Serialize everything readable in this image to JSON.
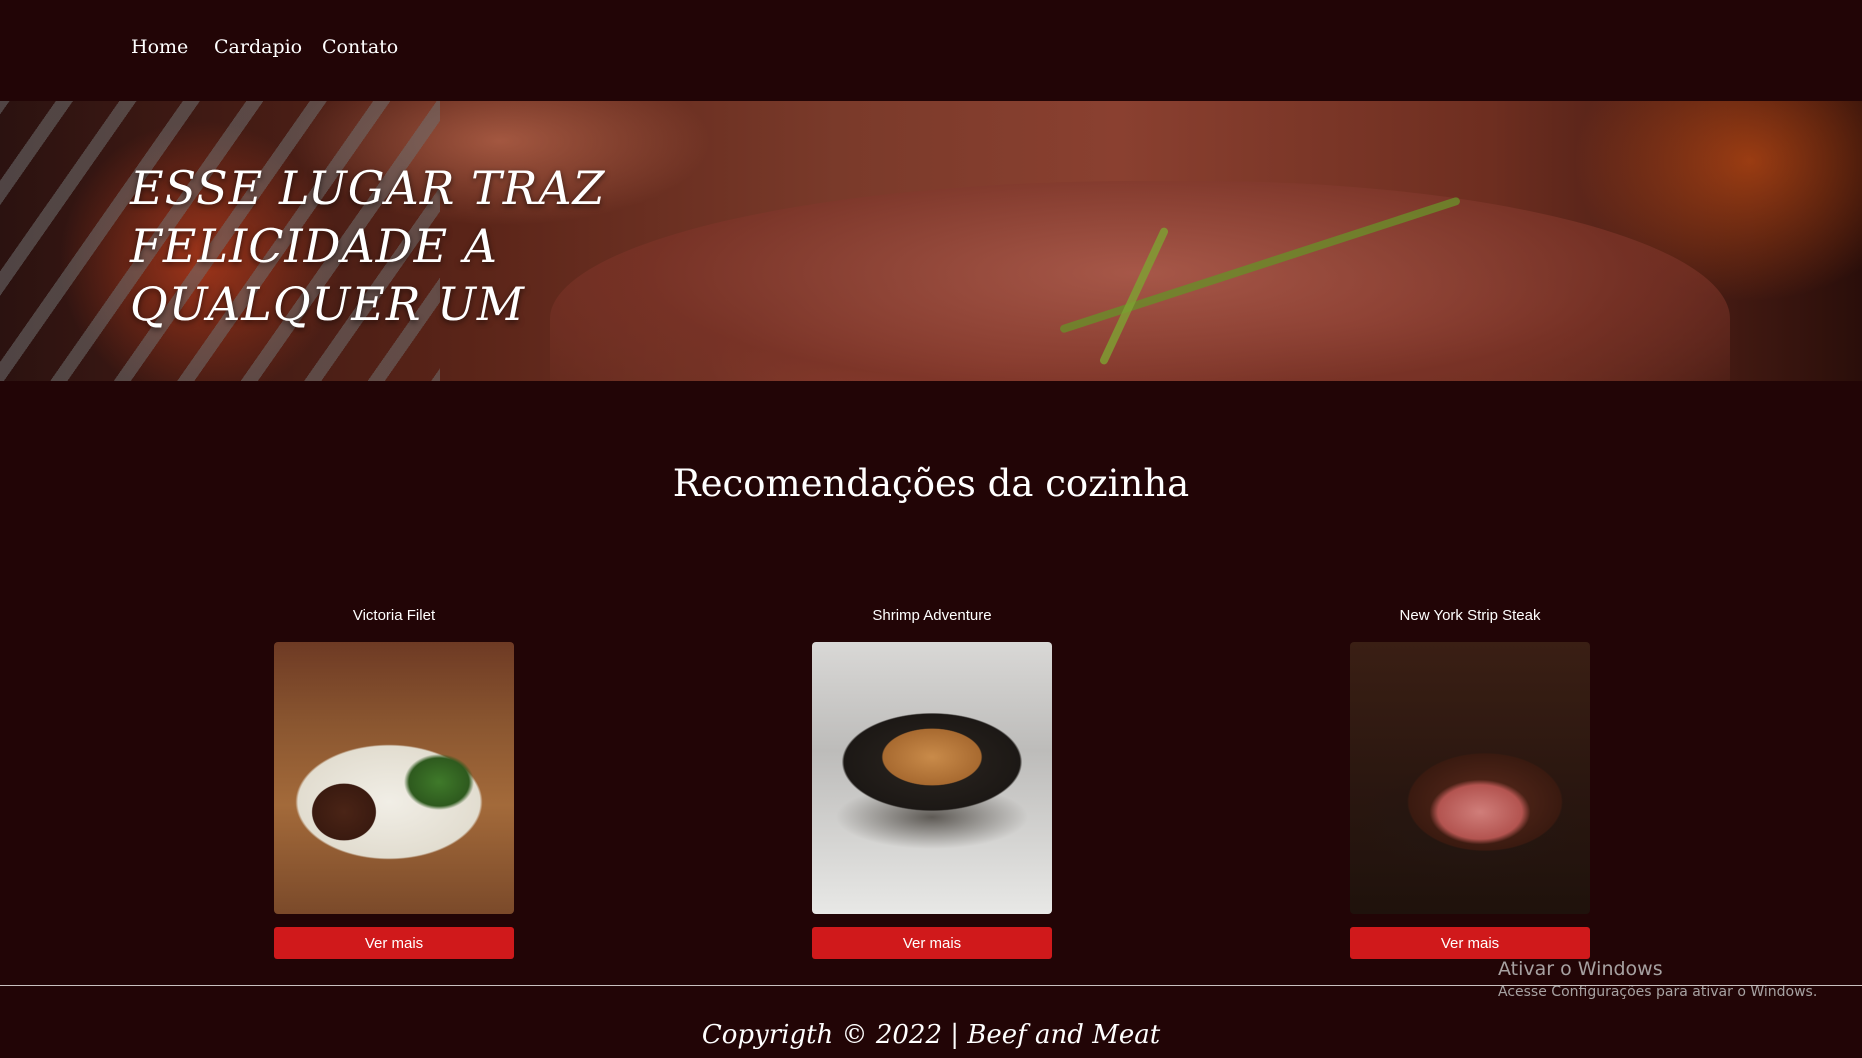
{
  "nav": {
    "home": "Home",
    "cardapio": "Cardapio",
    "contato": "Contato"
  },
  "hero": {
    "headline_line1": "ESSE LUGAR TRAZ FELICIDADE A",
    "headline_line2": "QUALQUER UM"
  },
  "recommendations": {
    "title": "Recomendações da cozinha",
    "items": [
      {
        "name": "Victoria Filet",
        "button": "Ver mais"
      },
      {
        "name": "Shrimp Adventure",
        "button": "Ver mais"
      },
      {
        "name": "New York Strip Steak",
        "button": "Ver mais"
      }
    ]
  },
  "footer": {
    "text": "Copyrigth © 2022 | Beef and Meat"
  },
  "os_watermark": {
    "title": "Ativar o Windows",
    "subtitle": "Acesse Configurações para ativar o Windows."
  },
  "colors": {
    "background": "#220506",
    "button": "#d0191b",
    "text": "#ffffff"
  }
}
